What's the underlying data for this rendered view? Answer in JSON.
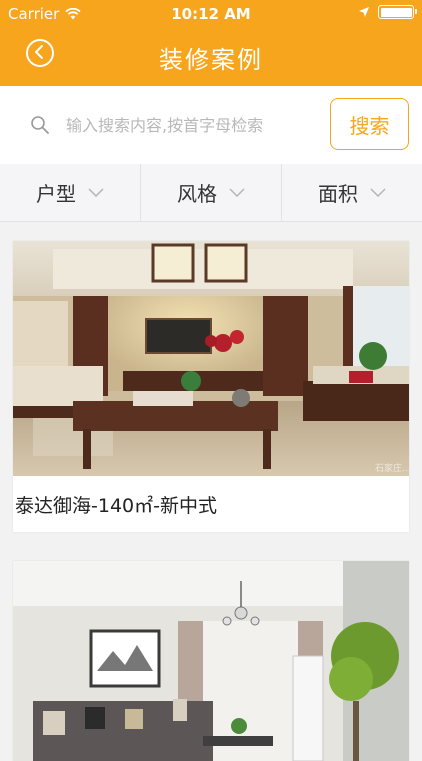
{
  "status_bar": {
    "carrier": "Carrier",
    "time": "10:12 AM",
    "battery_level": 1.0
  },
  "nav": {
    "title": "装修案例",
    "back_icon": "chevron-left-circle-icon",
    "bar_color": "#f6a51c"
  },
  "search": {
    "placeholder": "输入搜索内容,按首字母检索",
    "value": "",
    "button_label": "搜索"
  },
  "filters": [
    {
      "label": "户型"
    },
    {
      "label": "风格"
    },
    {
      "label": "面积"
    }
  ],
  "cases": [
    {
      "caption": "泰达御海-140㎡-新中式",
      "watermark": "石家庄..."
    },
    {
      "caption": ""
    }
  ],
  "colors": {
    "accent": "#f6a51c",
    "filter_bg": "#f5f5f7",
    "page_bg": "#f2f2f2"
  }
}
